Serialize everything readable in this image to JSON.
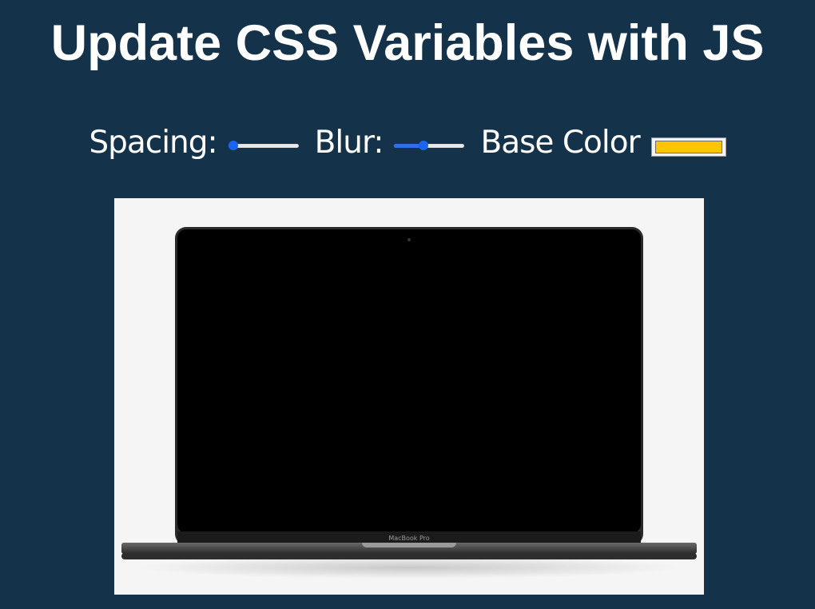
{
  "page": {
    "title": "Update CSS Variables with JS",
    "background_color": "#14334a"
  },
  "controls": {
    "spacing": {
      "label": "Spacing:",
      "value": 0.05
    },
    "blur": {
      "label": "Blur:",
      "value": 0.42
    },
    "base_color": {
      "label": "Base Color",
      "value": "#ffc600"
    }
  },
  "image": {
    "device_label": "MacBook Pro",
    "frame_color": "#f5f5f5"
  }
}
